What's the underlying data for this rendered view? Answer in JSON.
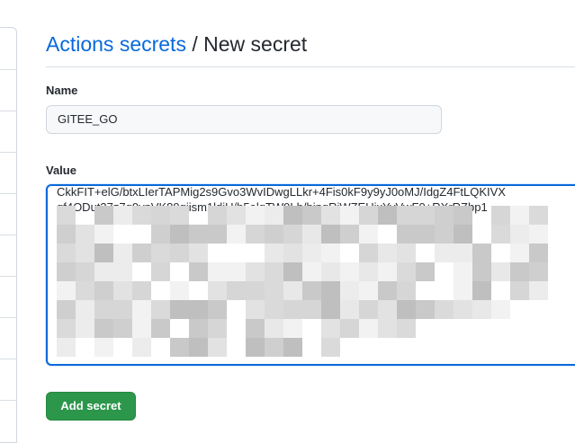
{
  "header": {
    "breadcrumb_link": "Actions secrets",
    "separator": "/",
    "current": "New secret"
  },
  "name_field": {
    "label": "Name",
    "value": "GITEE_GO"
  },
  "value_field": {
    "label": "Value",
    "visible_lines": [
      "CkkFIT+elG/btxLIerTAPMig2s9Gvo3WvIDwgLLkr+4Fis0kF9y9yJ0oMJ/IdgZ4FtLQKIVX",
      "gf4ODut37z7q9vnVK89qjism1ldiU/h5alqTW9Lh/hjngRjWZEUixYvVwF0+RXrRZbp1"
    ],
    "redacted": true
  },
  "add_button": {
    "label": "Add secret"
  }
}
